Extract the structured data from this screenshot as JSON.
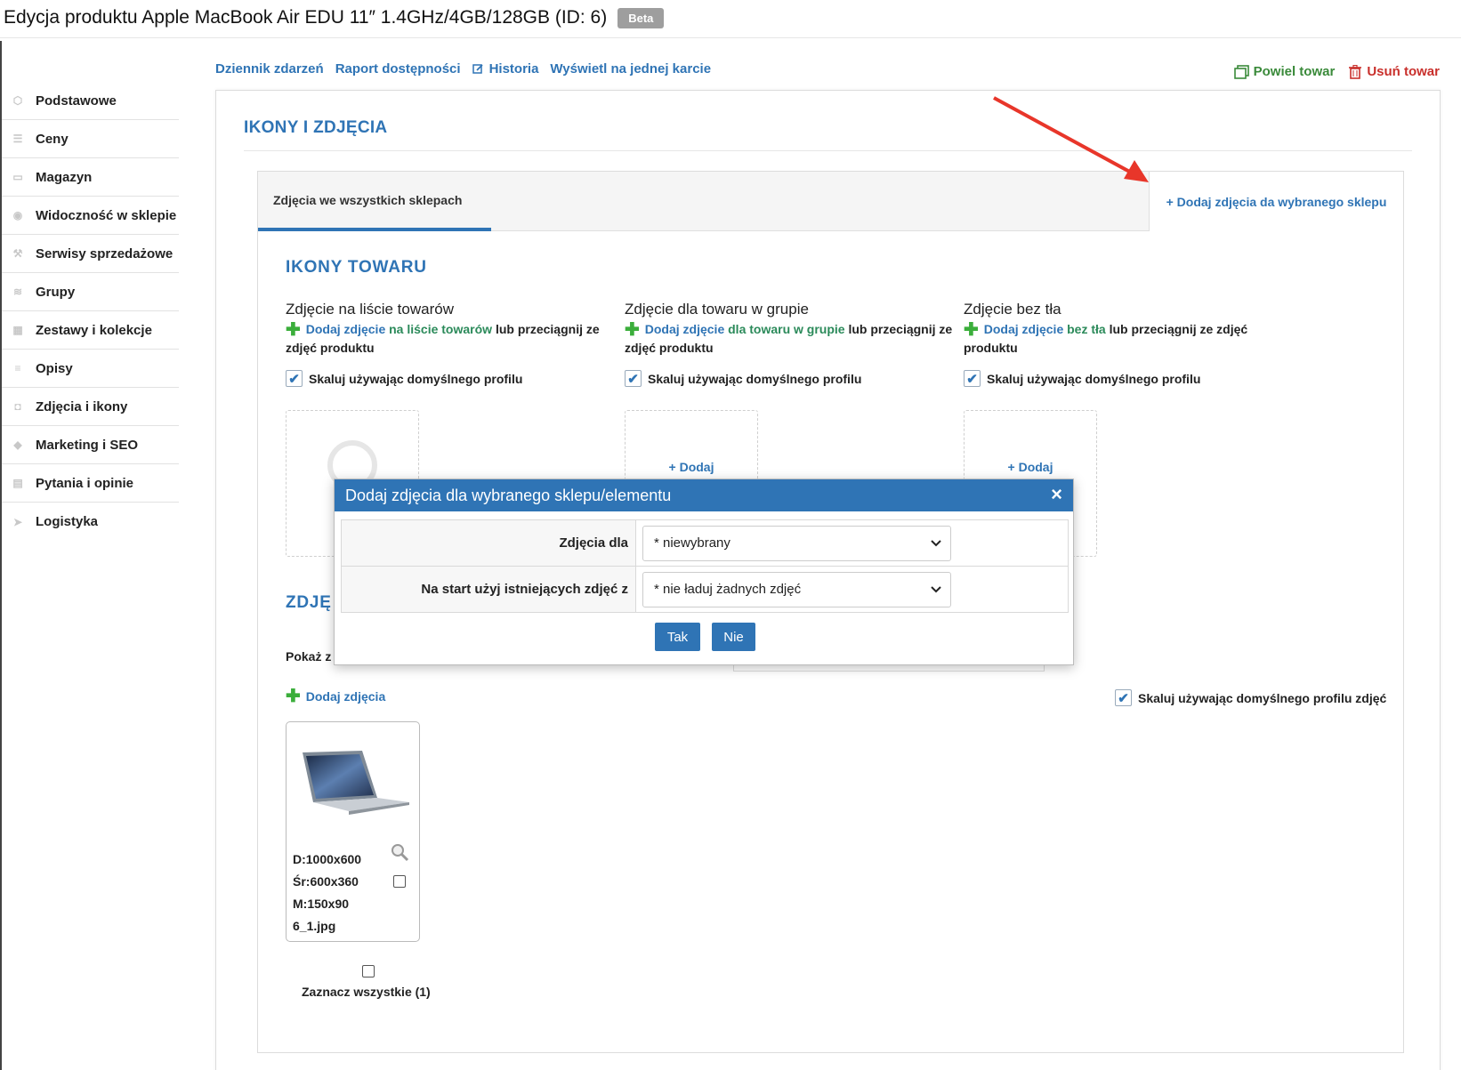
{
  "page": {
    "title": "Edycja produktu Apple MacBook Air EDU 11″ 1.4GHz/4GB/128GB (ID: 6)",
    "badge": "Beta"
  },
  "sidebar": {
    "items": [
      {
        "label": "Podstawowe",
        "icon": "cube-icon"
      },
      {
        "label": "Ceny",
        "icon": "coins-icon"
      },
      {
        "label": "Magazyn",
        "icon": "box-icon"
      },
      {
        "label": "Widoczność w sklepie",
        "icon": "eye-icon"
      },
      {
        "label": "Serwisy sprzedażowe",
        "icon": "gavel-icon"
      },
      {
        "label": "Grupy",
        "icon": "layers-icon"
      },
      {
        "label": "Zestawy i kolekcje",
        "icon": "collection-icon"
      },
      {
        "label": "Opisy",
        "icon": "text-icon"
      },
      {
        "label": "Zdjęcia i ikony",
        "icon": "camera-icon"
      },
      {
        "label": "Marketing i SEO",
        "icon": "tag-icon"
      },
      {
        "label": "Pytania i opinie",
        "icon": "comments-icon"
      },
      {
        "label": "Logistyka",
        "icon": "send-icon"
      }
    ]
  },
  "toplinks": {
    "journal": "Dziennik zdarzeń",
    "availability": "Raport dostępności",
    "history": "Historia",
    "single_card": "Wyświetl na jednej karcie"
  },
  "actions": {
    "duplicate": "Powiel towar",
    "delete": "Usuń towar"
  },
  "section": {
    "title": "IKONY I ZDJĘCIA"
  },
  "tabs": {
    "all_shops": "Zdjęcia we wszystkich sklepach",
    "add_shop": "+ Dodaj zdjęcia da wybranego sklepu"
  },
  "icons_section": {
    "title": "IKONY TOWARU",
    "columns": [
      {
        "title": "Zdjęcie na liście towarów",
        "link": "Dodaj zdjęcie",
        "mid": "na liście towarów",
        "rest": "lub przeciągnij ze zdjęć produktu",
        "checkbox": "Skaluj używając domyślnego profilu"
      },
      {
        "title": "Zdjęcie dla towaru w grupie",
        "link": "Dodaj zdjęcie",
        "mid": "dla towaru w grupie",
        "rest": "lub przeciągnij ze zdjęć produktu",
        "checkbox": "Skaluj używając domyślnego profilu",
        "dropzone": "+ Dodaj"
      },
      {
        "title": "Zdjęcie bez tła",
        "link": "Dodaj zdjęcie",
        "mid": "bez tła",
        "rest": "lub przeciągnij ze zdjęć produktu",
        "checkbox": "Skaluj używając domyślnego profilu",
        "dropzone": "+ Dodaj"
      }
    ]
  },
  "photos_section": {
    "title_partial": "ZDJĘ",
    "show_partial": "Pokaż z",
    "add_photos": "Dodaj zdjęcia",
    "scale_checkbox": "Skaluj używając domyślnego profilu zdjęć",
    "photo": {
      "d": "D:1000x600",
      "sr": "Śr:600x360",
      "m": "M:150x90",
      "file": "6_1.jpg"
    },
    "select_all": "Zaznacz wszystkie (1)"
  },
  "modal": {
    "title": "Dodaj zdjęcia dla wybranego sklepu/elementu",
    "close": "×",
    "rows": [
      {
        "label": "Zdjęcia dla",
        "value": "* niewybrany"
      },
      {
        "label": "Na start użyj istniejących zdjęć z",
        "value": "* nie ładuj żadnych zdjęć"
      }
    ],
    "yes": "Tak",
    "no": "Nie"
  },
  "colors": {
    "accent": "#2f74b5",
    "danger": "#c9302c",
    "success": "#3a8a3a",
    "arrow": "#e8362a"
  }
}
